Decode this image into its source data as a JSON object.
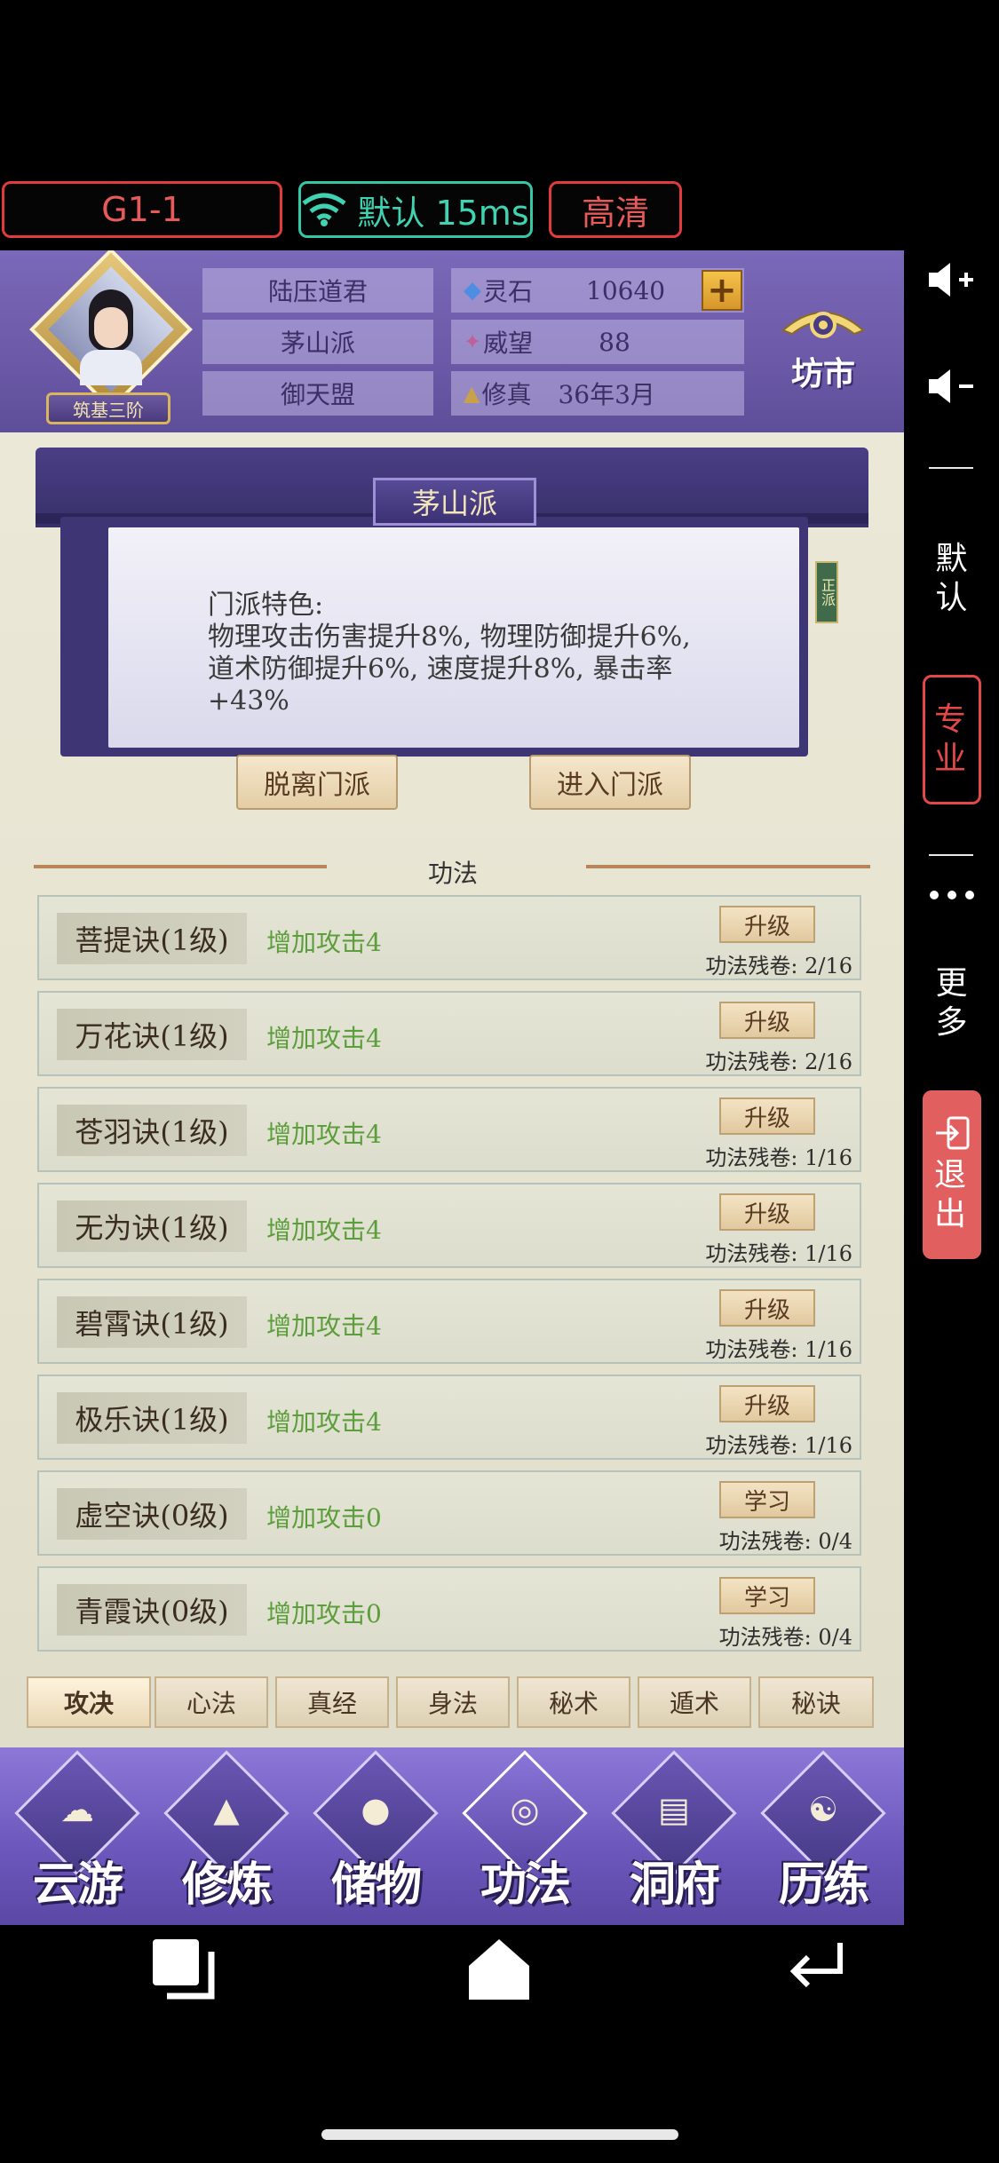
{
  "status": {
    "pills": [
      {
        "id": "level",
        "label": "G1-1"
      },
      {
        "id": "network",
        "label": "默认 15ms",
        "icon": "wifi-icon"
      },
      {
        "id": "quality",
        "label": "高清"
      }
    ]
  },
  "side_panel": {
    "volume_up_icon": "volume-up-icon",
    "volume_down_icon": "volume-down-icon",
    "default_label": "默认",
    "pro_label": "专业",
    "more_label": "更多",
    "exit_label": "退出"
  },
  "player": {
    "name": "陆压道君",
    "sect": "茅山派",
    "alliance": "御天盟",
    "realm_badge": "筑基三阶",
    "stats": [
      {
        "icon": "spirit-stone-icon",
        "label": "灵石",
        "value": "10640"
      },
      {
        "icon": "prestige-icon",
        "label": "威望",
        "value": "88"
      },
      {
        "icon": "cultivation-icon",
        "label": "修真",
        "value": "36年3月"
      }
    ],
    "add_button": "+",
    "market_label": "坊市"
  },
  "sect_panel": {
    "title": "茅山派",
    "side_tag": "正派",
    "feature_text": "门派特色:\n物理攻击伤害提升8%, 物理防御提升6%, 道术防御提升6%, 速度提升8%, 暴击率+43%",
    "leave_button": "脱离门派",
    "enter_button": "进入门派"
  },
  "skills": {
    "section_title": "功法",
    "rows": [
      {
        "name": "菩提诀(1级)",
        "effect": "增加攻击4",
        "button": "升级",
        "progress": "功法残卷: 2/16"
      },
      {
        "name": "万花诀(1级)",
        "effect": "增加攻击4",
        "button": "升级",
        "progress": "功法残卷: 2/16"
      },
      {
        "name": "苍羽诀(1级)",
        "effect": "增加攻击4",
        "button": "升级",
        "progress": "功法残卷: 1/16"
      },
      {
        "name": "无为诀(1级)",
        "effect": "增加攻击4",
        "button": "升级",
        "progress": "功法残卷: 1/16"
      },
      {
        "name": "碧霄诀(1级)",
        "effect": "增加攻击4",
        "button": "升级",
        "progress": "功法残卷: 1/16"
      },
      {
        "name": "极乐诀(1级)",
        "effect": "增加攻击4",
        "button": "升级",
        "progress": "功法残卷: 1/16"
      },
      {
        "name": "虚空诀(0级)",
        "effect": "增加攻击0",
        "button": "学习",
        "progress": "功法残卷: 0/4"
      },
      {
        "name": "青霞诀(0级)",
        "effect": "增加攻击0",
        "button": "学习",
        "progress": "功法残卷: 0/4"
      }
    ],
    "tabs": [
      "攻决",
      "心法",
      "真经",
      "身法",
      "秘术",
      "遁术",
      "秘诀"
    ]
  },
  "bottom_nav": [
    {
      "label": "云游",
      "icon": "cloud-icon"
    },
    {
      "label": "修炼",
      "icon": "pagoda-icon"
    },
    {
      "label": "储物",
      "icon": "bag-icon"
    },
    {
      "label": "功法",
      "icon": "skill-icon"
    },
    {
      "label": "洞府",
      "icon": "cave-icon"
    },
    {
      "label": "历练",
      "icon": "yinyang-icon"
    }
  ],
  "system_nav": {
    "recent_icon": "recent-apps-icon",
    "home_icon": "home-icon",
    "back_icon": "back-icon"
  }
}
